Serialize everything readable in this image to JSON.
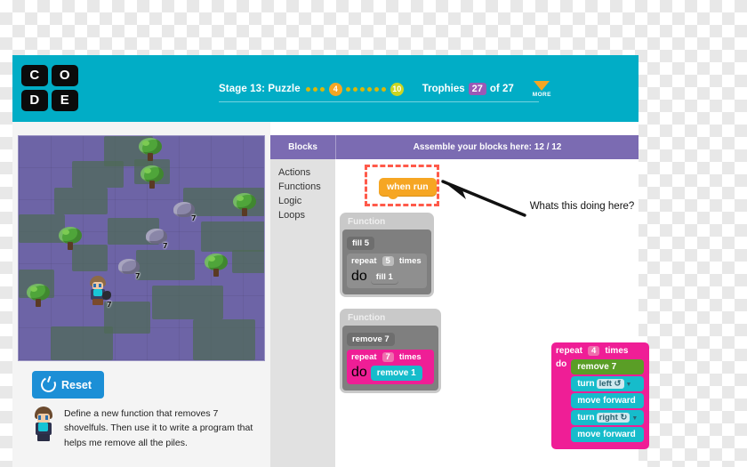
{
  "header": {
    "logo_letters": [
      "C",
      "O",
      "D",
      "E"
    ],
    "stage_label": "Stage 13: Puzzle",
    "dots_before": 3,
    "current_puzzle": "4",
    "dots_between": 6,
    "total_puzzles": "10",
    "trophies_label": "Trophies",
    "trophies_count": "27",
    "trophies_of": "of 27",
    "more_label": "MORE",
    "teal": "#01adc6",
    "accent_orange": "#f5a623",
    "badge_purple": "#9b59b6"
  },
  "game": {
    "reset_label": "Reset",
    "reset_icon": "power-refresh-icon",
    "instruction": "Define a new function that removes 7 shovelfuls. Then use it to write a program that helps me remove all the piles.",
    "pile_labels": [
      "7",
      "7",
      "7",
      "7"
    ]
  },
  "panel": {
    "blocks_tab": "Blocks",
    "assemble_label": "Assemble your blocks here: 12 / 12",
    "toolbox": [
      "Actions",
      "Functions",
      "Logic",
      "Loops"
    ],
    "purple": "#7b6bb2"
  },
  "workspace": {
    "when_run": "when run",
    "highlight_color": "#ff5a4a",
    "annotation": "Whats this doing here?",
    "function_one": {
      "title": "Function",
      "name_block": "fill 5",
      "repeat_word": "repeat",
      "repeat_count": "5",
      "times_word": "times",
      "do_word": "do",
      "inner_block": "fill 1"
    },
    "function_two": {
      "title": "Function",
      "name_block": "remove 7",
      "repeat_word": "repeat",
      "repeat_count": "7",
      "times_word": "times",
      "do_word": "do",
      "inner_block": "remove 1"
    },
    "program": {
      "repeat_word": "repeat",
      "repeat_count": "4",
      "times_word": "times",
      "do_word": "do",
      "statements": [
        {
          "label": "remove 7",
          "color": "green"
        },
        {
          "label": "turn",
          "dropdown": "left ↺",
          "color": "cyan"
        },
        {
          "label": "move forward",
          "color": "cyan"
        },
        {
          "label": "turn",
          "dropdown": "right ↻",
          "color": "cyan"
        },
        {
          "label": "move forward",
          "color": "cyan"
        }
      ]
    }
  }
}
